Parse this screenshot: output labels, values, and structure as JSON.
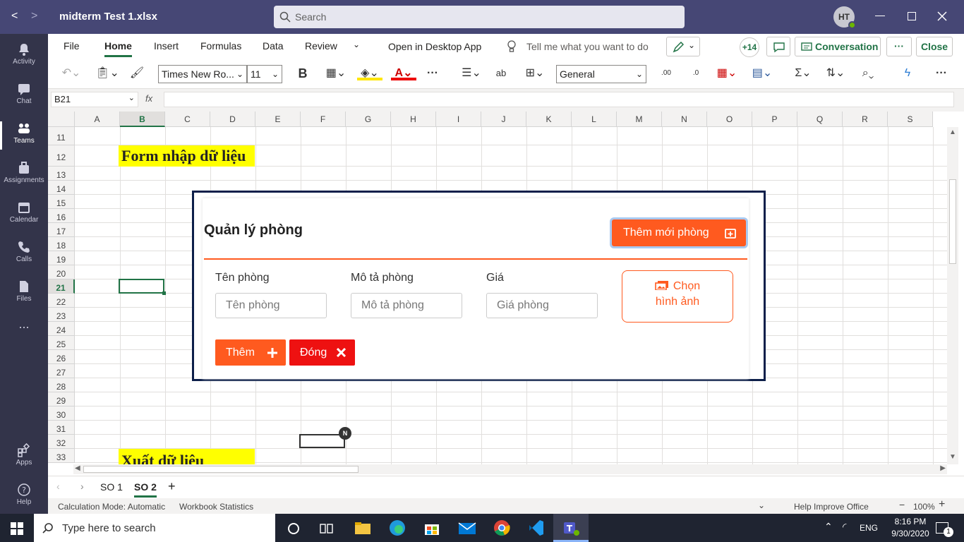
{
  "titlebar": {
    "file_title": "midterm Test 1.xlsx",
    "search_placeholder": "Search",
    "avatar_initials": "HT",
    "back": "<",
    "forward": ">"
  },
  "rail": [
    {
      "label": "Activity",
      "icon": "bell-icon"
    },
    {
      "label": "Chat",
      "icon": "chat-icon"
    },
    {
      "label": "Teams",
      "icon": "teams-icon"
    },
    {
      "label": "Assignments",
      "icon": "assignments-icon"
    },
    {
      "label": "Calendar",
      "icon": "calendar-icon"
    },
    {
      "label": "Calls",
      "icon": "phone-icon"
    },
    {
      "label": "Files",
      "icon": "file-icon"
    },
    {
      "label": "...",
      "icon": "more-icon"
    },
    {
      "label": "Apps",
      "icon": "apps-icon"
    },
    {
      "label": "Help",
      "icon": "help-icon"
    }
  ],
  "menubar": {
    "tabs": [
      "File",
      "Home",
      "Insert",
      "Formulas",
      "Data",
      "Review"
    ],
    "open_desktop": "Open in Desktop App",
    "tell_me": "Tell me what you want to do",
    "plus_count": "+14",
    "conversation": "Conversation",
    "more": "···",
    "close": "Close"
  },
  "ribbon": {
    "font_name": "Times New Ro...",
    "font_size": "11",
    "bold": "B",
    "number_format": "General"
  },
  "formulabar": {
    "namebox": "B21",
    "fx": "fx",
    "formula": ""
  },
  "grid": {
    "columns": [
      "A",
      "B",
      "C",
      "D",
      "E",
      "F",
      "G",
      "H",
      "I",
      "J",
      "K",
      "L",
      "M",
      "N",
      "O",
      "P",
      "Q",
      "R",
      "S"
    ],
    "rows": [
      "11",
      "12",
      "13",
      "14",
      "15",
      "16",
      "17",
      "18",
      "19",
      "20",
      "21",
      "22",
      "23",
      "24",
      "25",
      "26",
      "27",
      "28",
      "29",
      "30",
      "31",
      "32",
      "33"
    ],
    "cell_b12": "Form nhập dữ liệu",
    "cell_b33": "Xuất  dữ liệu",
    "presence_badge": "N"
  },
  "form": {
    "title": "Quản lý phòng",
    "add_room_button": "Thêm mới phòng",
    "fields": [
      {
        "label": "Tên phòng",
        "placeholder": "Tên phòng"
      },
      {
        "label": "Mô tả phòng",
        "placeholder": "Mô tả phòng"
      },
      {
        "label": "Giá",
        "placeholder": "Giá phòng"
      }
    ],
    "choose_image_line1": "Chọn",
    "choose_image_line2": "hình ảnh",
    "add_button": "Thêm",
    "close_button": "Đóng",
    "accent": "#ff5a1f",
    "danger": "#ee1111"
  },
  "sheettabs": {
    "tabs": [
      "SO 1",
      "SO 2"
    ],
    "active": "SO 2",
    "add": "+"
  },
  "statusbar": {
    "calc_mode": "Calculation Mode: Automatic",
    "workbook_stats": "Workbook Statistics",
    "help_improve": "Help Improve Office",
    "zoom": "100%"
  },
  "taskbar": {
    "search_placeholder": "Type here to search",
    "lang": "ENG",
    "time": "8:16 PM",
    "date": "9/30/2020",
    "notif_count": "1"
  }
}
